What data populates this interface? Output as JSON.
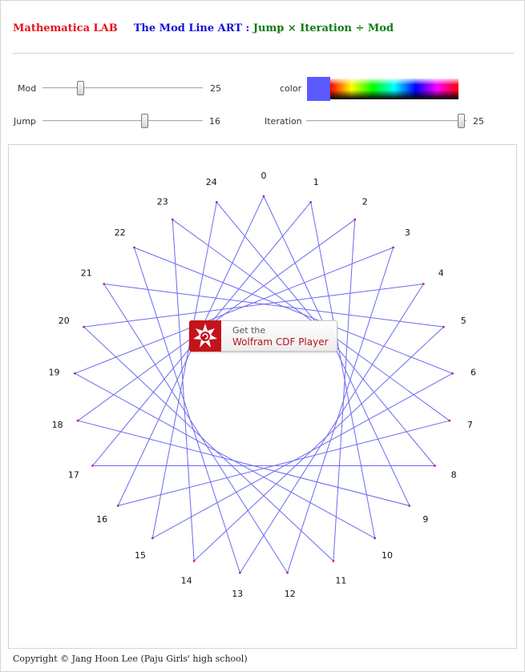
{
  "header": {
    "lab_title": "Mathematica LAB",
    "art_title": "The Mod Line ART :",
    "formula": "Jump × Iteration ÷ Mod"
  },
  "controls": {
    "mod": {
      "label": "Mod",
      "value": 25,
      "display": "25",
      "min": 2,
      "max": 100
    },
    "jump": {
      "label": "Jump",
      "value": 16,
      "display": "16",
      "min": 1,
      "max": 25
    },
    "iteration": {
      "label": "Iteration",
      "value": 25,
      "display": "25",
      "min": 1,
      "max": 25
    },
    "color": {
      "label": "color",
      "value": "#5a5aff"
    }
  },
  "plot": {
    "line_color": "#6a6af0",
    "point_color": "#c02090",
    "labels": [
      "0",
      "1",
      "2",
      "3",
      "4",
      "5",
      "6",
      "7",
      "8",
      "9",
      "10",
      "11",
      "12",
      "13",
      "14",
      "15",
      "16",
      "17",
      "18",
      "19",
      "20",
      "21",
      "22",
      "23",
      "24"
    ]
  },
  "cdf_button": {
    "line1": "Get the",
    "line2": "Wolfram CDF Player",
    "logo": "wolfram-spikey-icon"
  },
  "footer": {
    "copyright": "Copyright © Jang Hoon Lee (Paju Girls' high school)"
  }
}
